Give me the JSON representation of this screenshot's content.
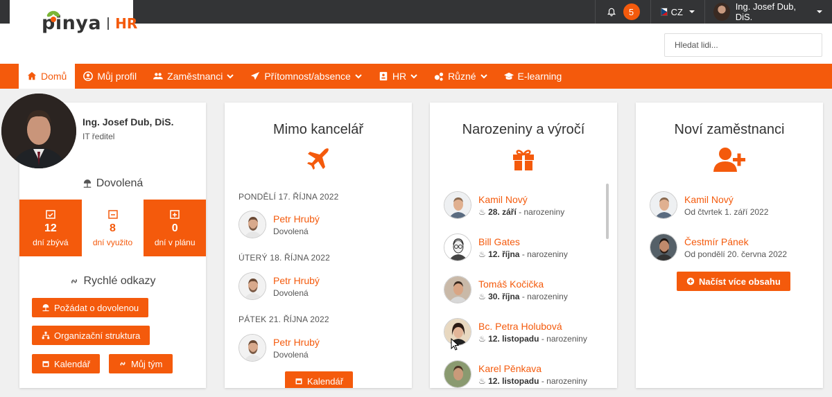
{
  "topbar": {
    "notifications_count": "5",
    "language": "CZ",
    "user_name": "Ing. Josef Dub, DiS."
  },
  "header": {
    "logo_text": "pinya",
    "logo_suffix": "HR",
    "search_placeholder": "Hledat lidi..."
  },
  "nav": {
    "items": [
      {
        "label": "Domů",
        "icon": "home-icon"
      },
      {
        "label": "Můj profil",
        "icon": "user-circle-icon"
      },
      {
        "label": "Zaměstnanci",
        "icon": "users-icon"
      },
      {
        "label": "Přítomnost/absence",
        "icon": "plane-icon"
      },
      {
        "label": "HR",
        "icon": "id-card-icon"
      },
      {
        "label": "Různé",
        "icon": "cogs-icon"
      },
      {
        "label": "E-learning",
        "icon": "graduation-cap-icon"
      }
    ]
  },
  "profile": {
    "name": "Ing. Josef Dub, DiS.",
    "role": "IT ředitel",
    "vacation_title": "Dovolená",
    "stats": [
      {
        "value": "12",
        "label": "dní zbývá"
      },
      {
        "value": "8",
        "label": "dní využito"
      },
      {
        "value": "0",
        "label": "dní v plánu"
      }
    ],
    "links_title": "Rychlé odkazy",
    "links": {
      "request_vacation": "Požádat o dovolenou",
      "org_structure": "Organizační struktura",
      "calendar": "Kalendář",
      "my_team": "Můj tým"
    }
  },
  "out_of_office": {
    "title": "Mimo kancelář",
    "days": [
      {
        "date": "PONDĚLÍ 17. ŘÍJNA 2022",
        "name": "Petr Hrubý",
        "reason": "Dovolená"
      },
      {
        "date": "ÚTERÝ 18. ŘÍJNA 2022",
        "name": "Petr Hrubý",
        "reason": "Dovolená"
      },
      {
        "date": "PÁTEK 21. ŘÍJNA 2022",
        "name": "Petr Hrubý",
        "reason": "Dovolená"
      }
    ],
    "calendar_button": "Kalendář"
  },
  "birthdays": {
    "title": "Narozeniny a výročí",
    "items": [
      {
        "name": "Kamil Nový",
        "date": "28. září",
        "type": "- narozeniny"
      },
      {
        "name": "Bill Gates",
        "date": "12. října",
        "type": "- narozeniny"
      },
      {
        "name": "Tomáš Kočička",
        "date": "30. října",
        "type": "- narozeniny"
      },
      {
        "name": "Bc. Petra Holubová",
        "date": "12. listopadu",
        "type": "- narozeniny"
      },
      {
        "name": "Karel Pěnkava",
        "date": "12. listopadu",
        "type": "- narozeniny"
      }
    ]
  },
  "new_employees": {
    "title": "Noví zaměstnanci",
    "items": [
      {
        "name": "Kamil Nový",
        "since": "Od čtvrtek 1. září 2022"
      },
      {
        "name": "Čestmír Pánek",
        "since": "Od pondělí 20. června 2022"
      }
    ],
    "load_more": "Načíst více obsahu"
  },
  "colors": {
    "accent": "#f45a0c",
    "topbar": "#333436"
  }
}
